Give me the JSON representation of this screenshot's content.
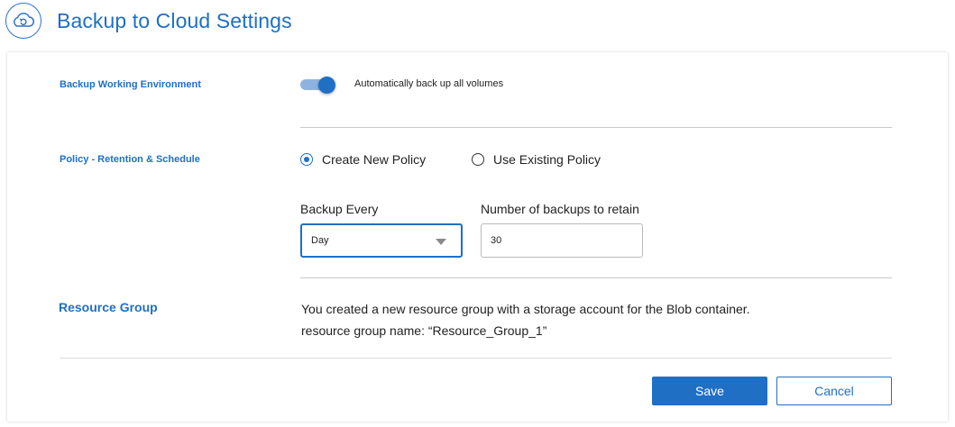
{
  "header": {
    "title": "Backup to Cloud Settings",
    "icon": "cloud-backup-icon"
  },
  "working_environment": {
    "label": "Backup Working Environment",
    "toggle_on": true,
    "toggle_text": "Automatically back up all volumes"
  },
  "policy": {
    "label": "Policy - Retention & Schedule",
    "options": [
      {
        "label": "Create New Policy",
        "selected": true
      },
      {
        "label": "Use Existing Policy",
        "selected": false
      }
    ],
    "backup_every_label": "Backup Every",
    "backup_every_value": "Day",
    "retain_label": "Number of backups to retain",
    "retain_value": "30"
  },
  "resource_group": {
    "label": "Resource Group",
    "line1": "You created a new resource group with a storage account for the Blob container.",
    "line2": "resource group name: “Resource_Group_1”"
  },
  "footer": {
    "save_label": "Save",
    "cancel_label": "Cancel"
  },
  "colors": {
    "accent": "#1f6fc5",
    "toggle_track": "#8fb3e0",
    "divider": "#c9c9c9"
  }
}
